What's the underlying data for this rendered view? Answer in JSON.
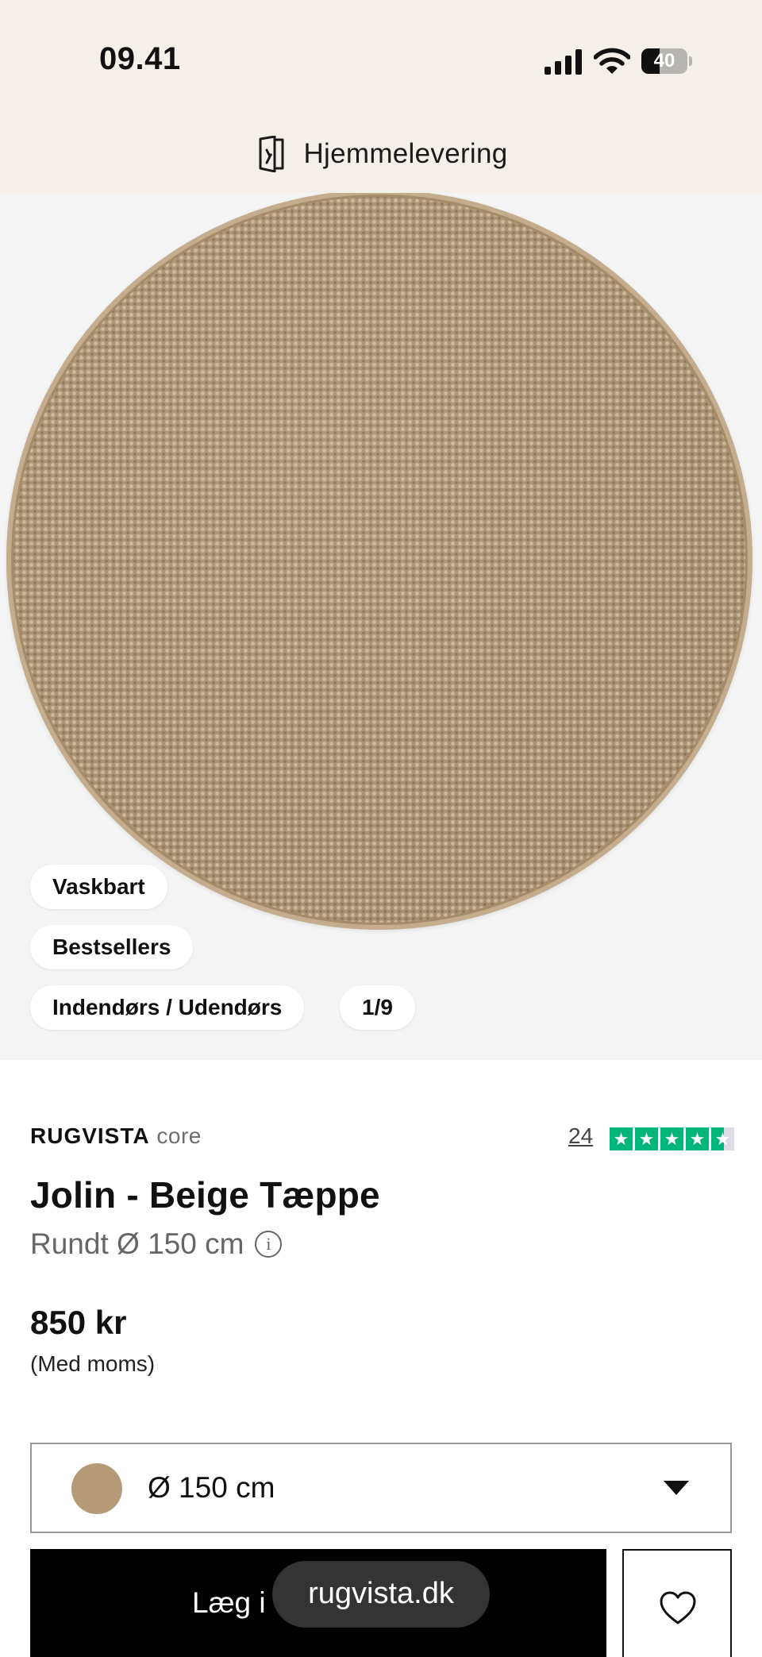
{
  "status_bar": {
    "time": "09.41",
    "battery": "40",
    "battery_level": 0.4,
    "icons": [
      "cellular-signal-icon",
      "wifi-icon",
      "battery-icon"
    ]
  },
  "banner": {
    "icon": "door-icon",
    "text": "Hjemmelevering"
  },
  "gallery": {
    "badges": [
      "Vaskbart",
      "Bestsellers",
      "Indendørs / Udendørs"
    ],
    "counter": "1/9"
  },
  "product": {
    "brand": "RUGVISTA",
    "brand_line": "core",
    "review_count": "24",
    "rating_stars": 4.5,
    "rating_color": "#00b67a",
    "title": "Jolin - Beige Tæppe",
    "size_text": "Rundt Ø 150 cm",
    "price": "850 kr",
    "vat_note": "(Med moms)"
  },
  "size_select": {
    "value": "Ø 150 cm",
    "swatch_color": "#b49a77"
  },
  "actions": {
    "cart_label": "Læg i",
    "favorite_icon": "heart-icon"
  },
  "browser": {
    "url": "rugvista.dk"
  }
}
